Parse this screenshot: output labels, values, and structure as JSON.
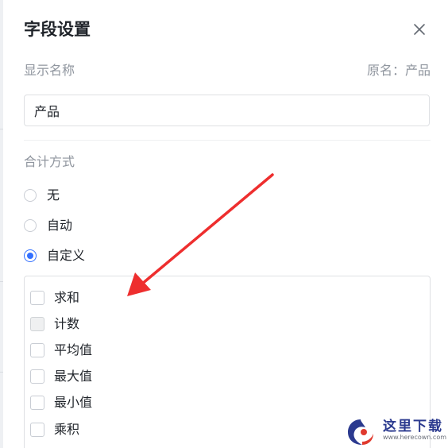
{
  "dialog": {
    "title": "字段设置"
  },
  "display_name": {
    "label": "显示名称",
    "original_name": "原名：产品",
    "value": "产品"
  },
  "aggregation": {
    "label": "合计方式",
    "options": [
      {
        "label": "无",
        "selected": false
      },
      {
        "label": "自动",
        "selected": false
      },
      {
        "label": "自定义",
        "selected": true
      }
    ],
    "custom_items": [
      {
        "label": "求和",
        "checked": false,
        "disabled": false
      },
      {
        "label": "计数",
        "checked": false,
        "disabled": true
      },
      {
        "label": "平均值",
        "checked": false,
        "disabled": false
      },
      {
        "label": "最大值",
        "checked": false,
        "disabled": false
      },
      {
        "label": "最小值",
        "checked": false,
        "disabled": false
      },
      {
        "label": "乘积",
        "checked": false,
        "disabled": false
      }
    ]
  },
  "colors": {
    "accent": "#3370ff",
    "annotation_arrow": "#ee2e2e",
    "text_primary": "#1f2329",
    "text_secondary": "#8f959e"
  },
  "watermark": {
    "text": "这里下载",
    "url": "www.herecown.com"
  },
  "icons": {
    "close": "close-icon"
  }
}
